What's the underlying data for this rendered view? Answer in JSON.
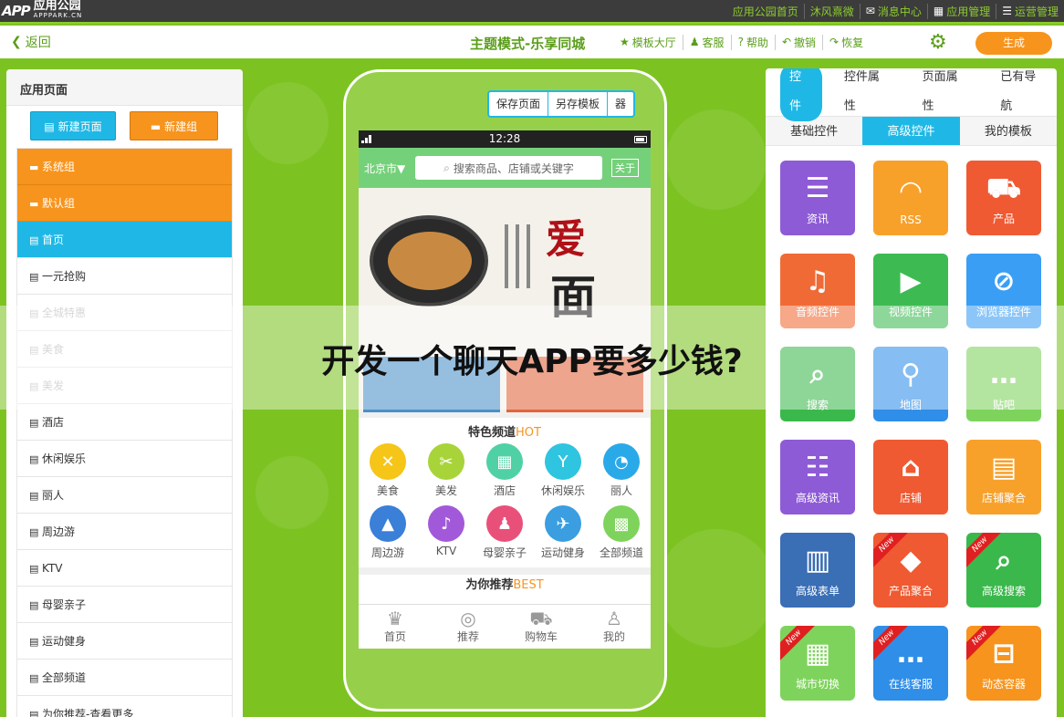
{
  "topbar": {
    "logo_mark": "APP",
    "logo_line1": "应用公园",
    "logo_line2": "APPPARK.CN",
    "links": [
      {
        "label": "应用公园首页",
        "icon": ""
      },
      {
        "label": "沐风熹微",
        "icon": ""
      },
      {
        "label": "消息中心",
        "icon": "mail-icon"
      },
      {
        "label": "应用管理",
        "icon": "grid-icon"
      },
      {
        "label": "运营管理",
        "icon": "list-icon"
      }
    ]
  },
  "toolbar": {
    "back_label": "返回",
    "title": "主题模式-乐享同城",
    "items": [
      {
        "label": "模板大厅",
        "icon": "star-icon"
      },
      {
        "label": "客服",
        "icon": "user-icon"
      },
      {
        "label": "帮助",
        "icon": "help-icon"
      },
      {
        "label": "撤销",
        "icon": "undo-icon"
      },
      {
        "label": "恢复",
        "icon": "redo-icon"
      }
    ],
    "generate_label": "生成"
  },
  "left_panel": {
    "title": "应用页面",
    "new_page_label": "新建页面",
    "new_group_label": "新建组",
    "items": [
      {
        "label": "系统组",
        "kind": "group"
      },
      {
        "label": "默认组",
        "kind": "group"
      },
      {
        "label": "首页",
        "kind": "active"
      },
      {
        "label": "一元抢购",
        "kind": "page"
      },
      {
        "label": "全城特惠",
        "kind": "dim"
      },
      {
        "label": "美食",
        "kind": "dim"
      },
      {
        "label": "美发",
        "kind": "dim"
      },
      {
        "label": "酒店",
        "kind": "page"
      },
      {
        "label": "休闲娱乐",
        "kind": "page"
      },
      {
        "label": "丽人",
        "kind": "page"
      },
      {
        "label": "周边游",
        "kind": "page"
      },
      {
        "label": "KTV",
        "kind": "page"
      },
      {
        "label": "母婴亲子",
        "kind": "page"
      },
      {
        "label": "运动健身",
        "kind": "page"
      },
      {
        "label": "全部频道",
        "kind": "page"
      },
      {
        "label": "为你推荐-查看更多",
        "kind": "page"
      }
    ]
  },
  "phone": {
    "buttons": [
      "保存页面",
      "另存模板",
      "器"
    ],
    "status_time": "12:28",
    "city": "北京市▼",
    "search_placeholder": "搜索商品、店铺或关键字",
    "follow_label": "关于",
    "banner_text_1": "爱",
    "banner_text_2": "面",
    "channel_title": "特色频道",
    "channel_hot": "HOT",
    "channels": [
      {
        "label": "美食",
        "color": "#f5c518",
        "glyph": "✕"
      },
      {
        "label": "美发",
        "color": "#a8d43a",
        "glyph": "✂"
      },
      {
        "label": "酒店",
        "color": "#4fd1a5",
        "glyph": "▦"
      },
      {
        "label": "休闲娱乐",
        "color": "#2fc4e0",
        "glyph": "Y"
      },
      {
        "label": "丽人",
        "color": "#2aa9e8",
        "glyph": "◔"
      },
      {
        "label": "周边游",
        "color": "#3a7fd8",
        "glyph": "▲"
      },
      {
        "label": "KTV",
        "color": "#a259d9",
        "glyph": "♪"
      },
      {
        "label": "母婴亲子",
        "color": "#e8507a",
        "glyph": "♟"
      },
      {
        "label": "运动健身",
        "color": "#3a9ee0",
        "glyph": "✈"
      },
      {
        "label": "全部频道",
        "color": "#7ed35c",
        "glyph": "▩"
      }
    ],
    "recommend_title": "为你推荐",
    "recommend_tag": "BEST",
    "tabs": [
      {
        "label": "首页",
        "glyph": "♛"
      },
      {
        "label": "推荐",
        "glyph": "◎"
      },
      {
        "label": "购物车",
        "glyph": "⛟"
      },
      {
        "label": "我的",
        "glyph": "♙"
      }
    ]
  },
  "right_panel": {
    "tabs": [
      "控件",
      "控件属性",
      "页面属性",
      "已有导航"
    ],
    "active_tab": 0,
    "sub_tabs": [
      "基础控件",
      "高级控件",
      "我的模板"
    ],
    "active_sub_tab": 1,
    "tiles": [
      {
        "label": "资讯",
        "color": "#8e5bd6",
        "glyph": "☰",
        "new": false
      },
      {
        "label": "RSS",
        "color": "#f7a12b",
        "glyph": "◠",
        "new": false
      },
      {
        "label": "产品",
        "color": "#ef5a32",
        "glyph": "⛟",
        "new": false
      },
      {
        "label": "音频控件",
        "color": "#f06a35",
        "glyph": "♫",
        "new": false
      },
      {
        "label": "视频控件",
        "color": "#3dbb52",
        "glyph": "▶",
        "new": false
      },
      {
        "label": "浏览器控件",
        "color": "#3a9ef5",
        "glyph": "⊘",
        "new": false
      },
      {
        "label": "搜索",
        "color": "#3bb84c",
        "glyph": "⌕",
        "new": false
      },
      {
        "label": "地图",
        "color": "#2f8ee8",
        "glyph": "⚲",
        "new": false
      },
      {
        "label": "贴吧",
        "color": "#7ed35c",
        "glyph": "…",
        "new": false
      },
      {
        "label": "高级资讯",
        "color": "#8e5bd6",
        "glyph": "☷",
        "new": false
      },
      {
        "label": "店铺",
        "color": "#ef5a32",
        "glyph": "⌂",
        "new": false
      },
      {
        "label": "店铺聚合",
        "color": "#f7a12b",
        "glyph": "▤",
        "new": false
      },
      {
        "label": "高级表单",
        "color": "#3a6eb5",
        "glyph": "▥",
        "new": false
      },
      {
        "label": "产品聚合",
        "color": "#ef5a32",
        "glyph": "◆",
        "new": true
      },
      {
        "label": "高级搜索",
        "color": "#3bb84c",
        "glyph": "⌕",
        "new": true
      },
      {
        "label": "城市切换",
        "color": "#7ed35c",
        "glyph": "▦",
        "new": true
      },
      {
        "label": "在线客服",
        "color": "#2f8ee8",
        "glyph": "…",
        "new": true
      },
      {
        "label": "动态容器",
        "color": "#f7941d",
        "glyph": "⊟",
        "new": true
      }
    ],
    "new_badge": "New"
  },
  "overlay": {
    "title": "开发一个聊天APP要多少钱?"
  },
  "colors": {
    "brand_green": "#7cc322",
    "accent_blue": "#1fb8e6",
    "accent_orange": "#f7941d"
  }
}
